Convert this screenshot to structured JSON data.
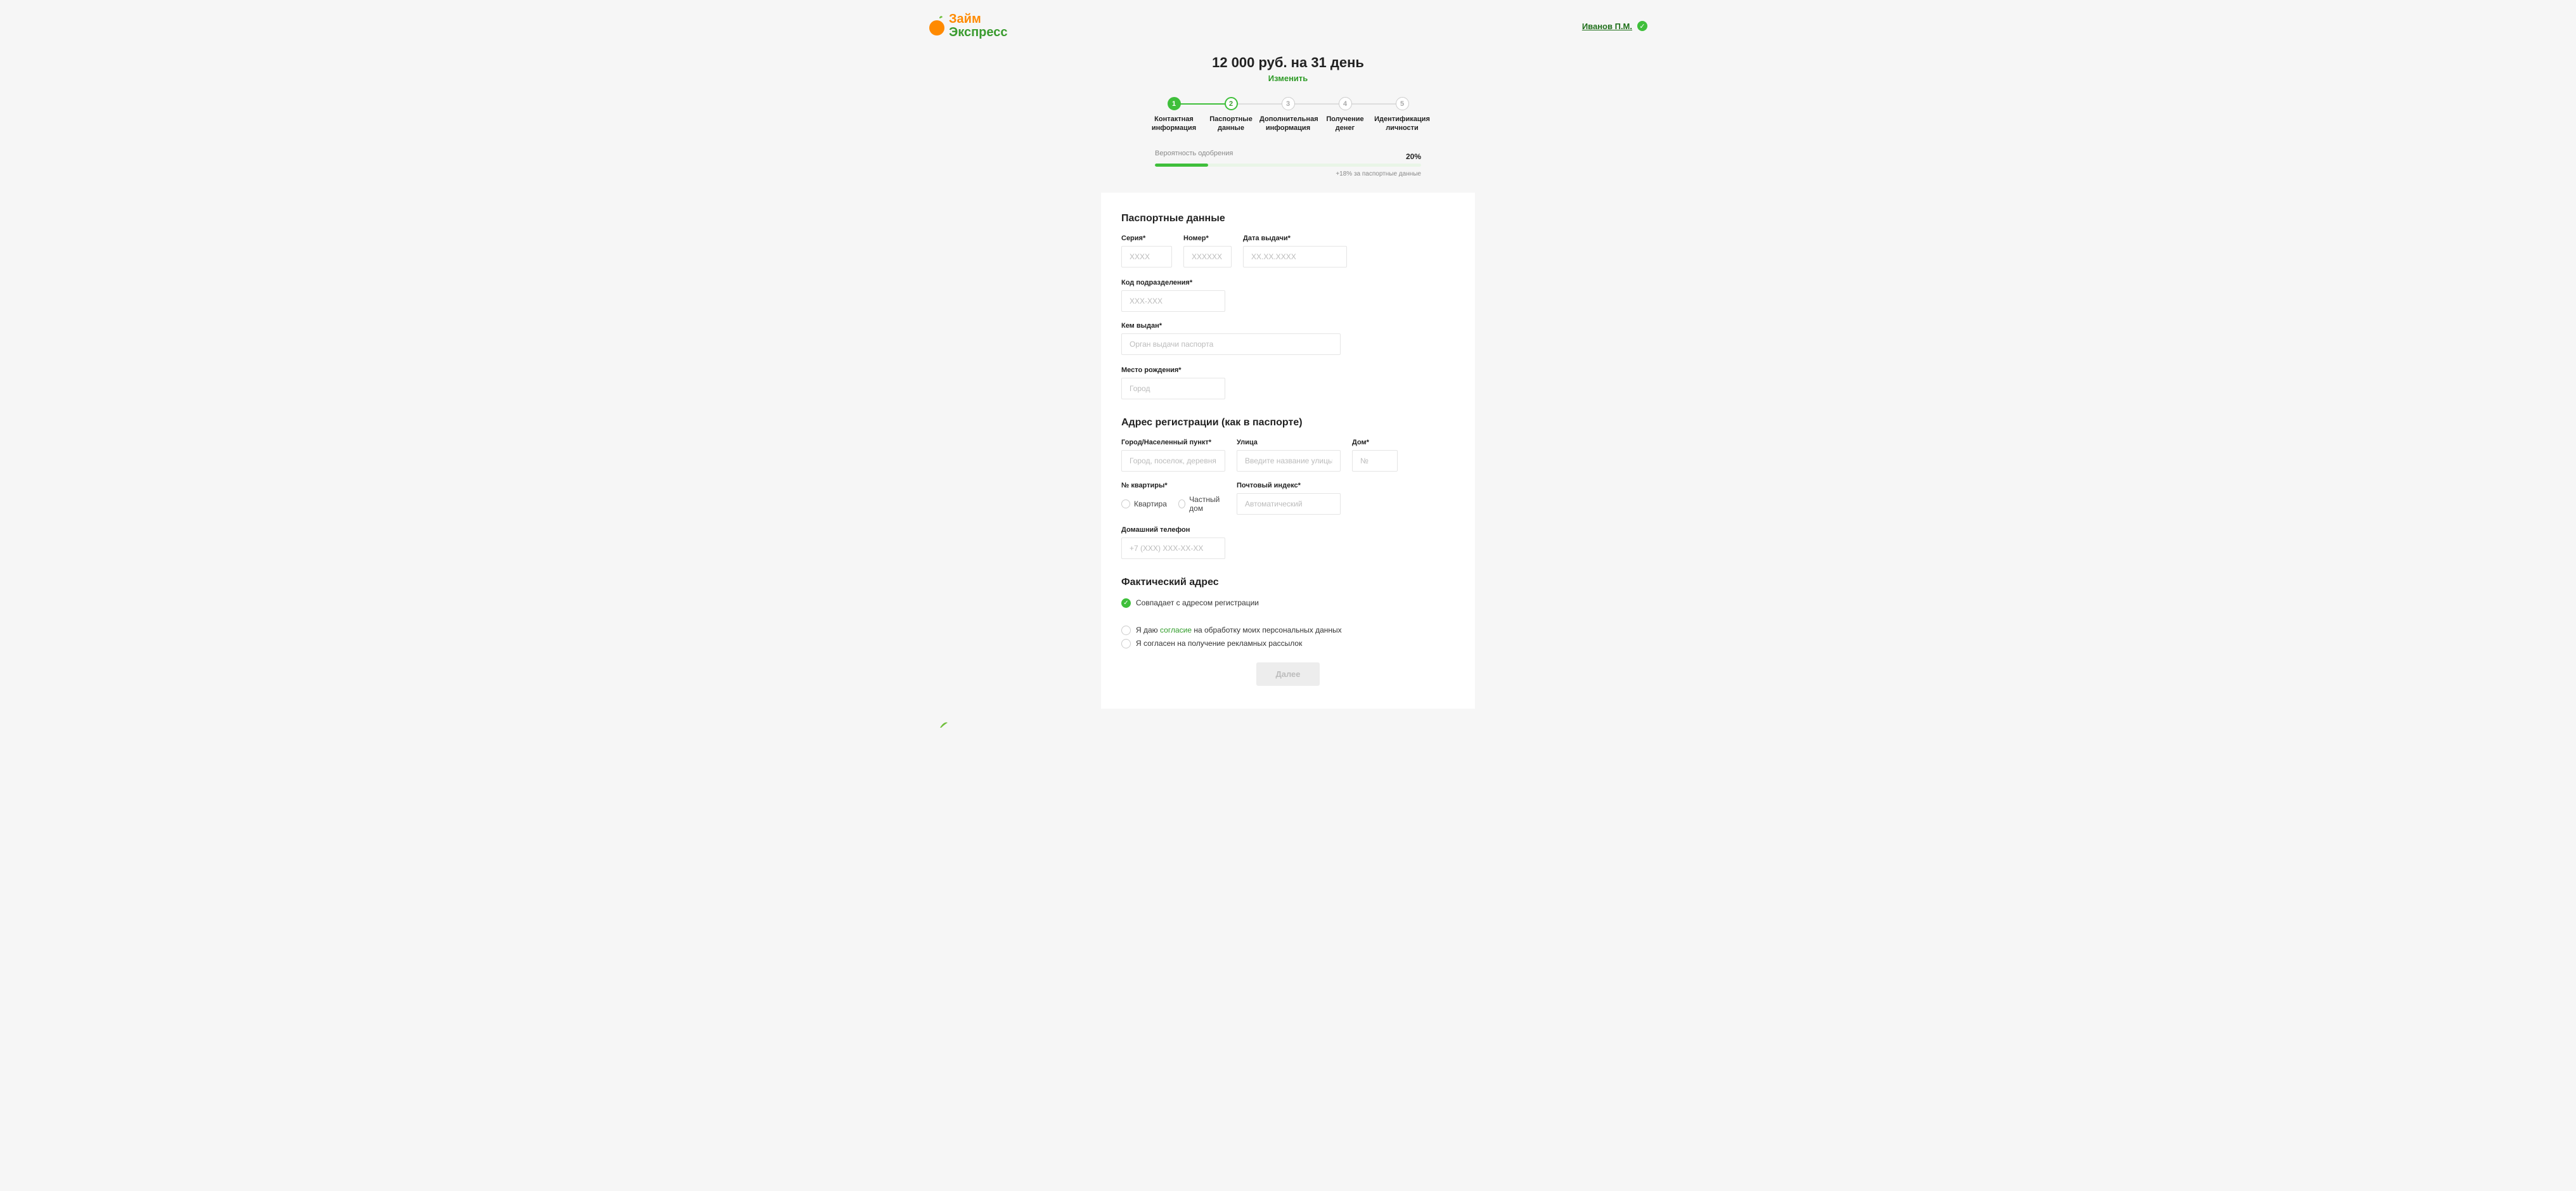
{
  "header": {
    "logo_l1": "Займ",
    "logo_l2": "Экспресс",
    "user_name": "Иванов П.М."
  },
  "summary": {
    "title": "12 000 руб. на 31 день",
    "change": "Изменить"
  },
  "stepper": {
    "steps": [
      {
        "num": "1",
        "label": "Контактная информация"
      },
      {
        "num": "2",
        "label": "Паспортные данные"
      },
      {
        "num": "3",
        "label": "Дополнительная информация"
      },
      {
        "num": "4",
        "label": "Получение денег"
      },
      {
        "num": "5",
        "label": "Идентификация личности"
      }
    ]
  },
  "approval": {
    "label": "Вероятность одобрения",
    "percent_text": "20%",
    "percent": 20,
    "hint": "+18% за паспортные данные"
  },
  "passport": {
    "title": "Паспортные данные",
    "series_label": "Серия*",
    "series_ph": "XXXX",
    "number_label": "Номер*",
    "number_ph": "XXXXXX",
    "issue_date_label": "Дата выдачи*",
    "issue_date_ph": "XX.XX.XXXX",
    "dept_code_label": "Код подразделения*",
    "dept_code_ph": "XXX-XXX",
    "issued_by_label": "Кем выдан*",
    "issued_by_ph": "Орган выдачи паспорта",
    "birth_place_label": "Место рождения*",
    "birth_place_ph": "Город"
  },
  "address": {
    "title": "Адрес регистрации (как в паспорте)",
    "city_label": "Город/Населенный пункт*",
    "city_ph": "Город, поселок, деревня и т.д.",
    "street_label": "Улица",
    "street_ph": "Введите название улицы",
    "house_label": "Дом*",
    "house_ph": "№",
    "apt_label": "№ квартиры*",
    "apt_opt1": "Квартира",
    "apt_opt2": "Частный дом",
    "zip_label": "Почтовый индекс*",
    "zip_ph": "Автоматический",
    "phone_label": "Домашний телефон",
    "phone_ph": "+7 (XXX) XXX-XX-XX"
  },
  "actual": {
    "title": "Фактический адрес",
    "same": "Совпадает с адресом регистрации"
  },
  "consents": {
    "personal_pre": "Я даю ",
    "personal_link": "согласие",
    "personal_post": " на обработку моих персональных данных",
    "ads": "Я согласен на получение рекламных рассылок"
  },
  "next_btn": "Далее"
}
